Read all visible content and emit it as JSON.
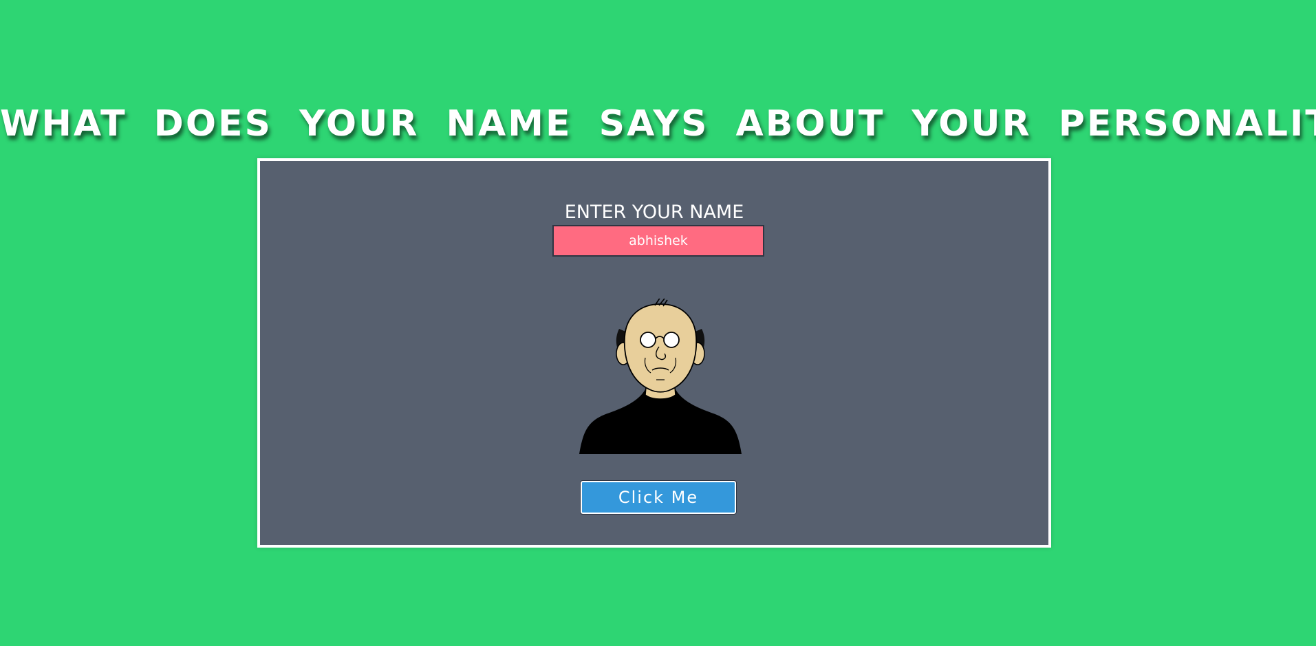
{
  "page": {
    "headline": "WHAT DOES YOUR NAME SAYS ABOUT YOUR PERSONALITY?"
  },
  "form": {
    "label": "ENTER YOUR NAME",
    "name_value": "abhishek",
    "button_label": "Click Me"
  },
  "illustration": {
    "icon": "bald-old-man-with-glasses-avatar"
  },
  "colors": {
    "background": "#2ed573",
    "card": "#57606f",
    "input": "#ff6b81",
    "button": "#3498db",
    "text": "#ffffff"
  }
}
